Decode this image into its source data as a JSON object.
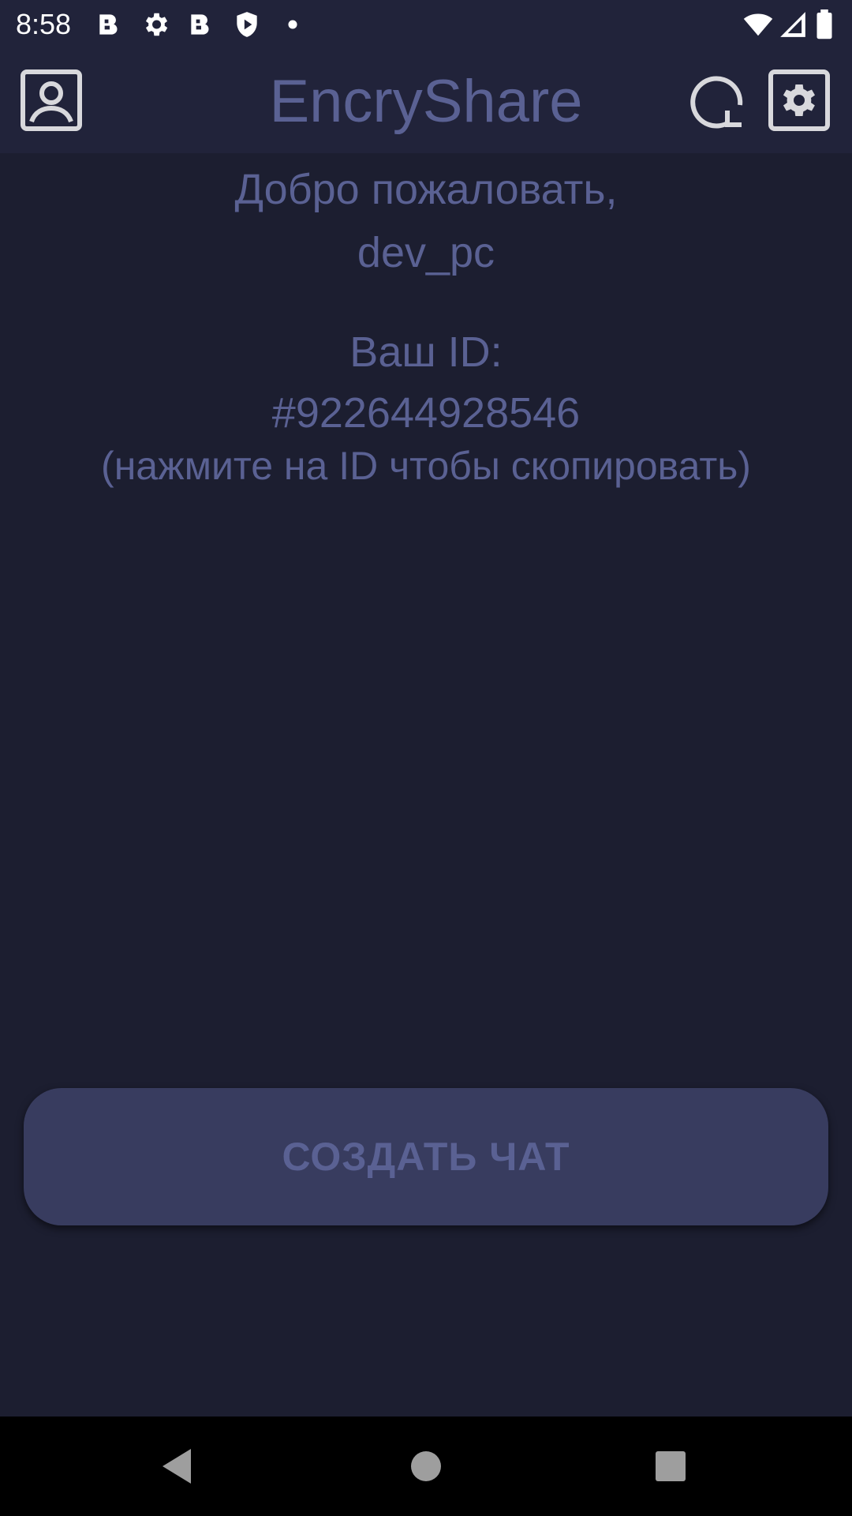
{
  "status_bar": {
    "time": "8:58",
    "icons": [
      "app-notification-icon",
      "gear-icon",
      "app-notification-icon",
      "play-protect-icon",
      "dot-icon",
      "wifi-icon",
      "signal-icon",
      "battery-icon"
    ]
  },
  "app_bar": {
    "title": "EncryShare",
    "left_icon": "profile-icon",
    "right_icons": [
      "refresh-icon",
      "settings-icon"
    ]
  },
  "main": {
    "welcome_line1": "Добро пожаловать,",
    "welcome_line2": "dev_pc",
    "id_label": "Ваш ID:",
    "id_value": "#922644928546",
    "id_hint": "(нажмите на ID чтобы скопировать)"
  },
  "actions": {
    "create_chat_label": "СОЗДАТЬ ЧАТ"
  },
  "nav_bar": {
    "icons": [
      "back-icon",
      "home-icon",
      "recents-icon"
    ]
  },
  "colors": {
    "background": "#1c1e30",
    "app_bar": "#21233a",
    "accent_text": "#5a6193",
    "button": "#383c5f"
  }
}
